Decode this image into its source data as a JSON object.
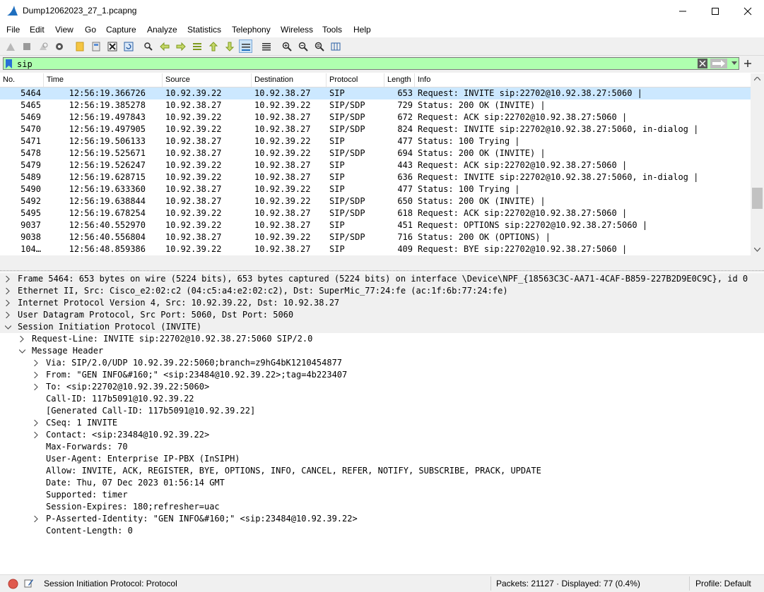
{
  "window": {
    "title": "Dump12062023_27_1.pcapng"
  },
  "menu": [
    "File",
    "Edit",
    "View",
    "Go",
    "Capture",
    "Analyze",
    "Statistics",
    "Telephony",
    "Wireless",
    "Tools",
    "Help"
  ],
  "filter": {
    "value": "sip"
  },
  "columns": [
    "No.",
    "Time",
    "Source",
    "Destination",
    "Protocol",
    "Length",
    "Info"
  ],
  "packets": [
    {
      "no": "5464",
      "time": "12:56:19.366726",
      "src": "10.92.39.22",
      "dst": "10.92.38.27",
      "proto": "SIP",
      "len": "653",
      "info": "Request: INVITE sip:22702@10.92.38.27:5060 |",
      "selected": true
    },
    {
      "no": "5465",
      "time": "12:56:19.385278",
      "src": "10.92.38.27",
      "dst": "10.92.39.22",
      "proto": "SIP/SDP",
      "len": "729",
      "info": "Status: 200 OK (INVITE) |"
    },
    {
      "no": "5469",
      "time": "12:56:19.497843",
      "src": "10.92.39.22",
      "dst": "10.92.38.27",
      "proto": "SIP/SDP",
      "len": "672",
      "info": "Request: ACK sip:22702@10.92.38.27:5060 |"
    },
    {
      "no": "5470",
      "time": "12:56:19.497905",
      "src": "10.92.39.22",
      "dst": "10.92.38.27",
      "proto": "SIP/SDP",
      "len": "824",
      "info": "Request: INVITE sip:22702@10.92.38.27:5060, in-dialog |"
    },
    {
      "no": "5471",
      "time": "12:56:19.506133",
      "src": "10.92.38.27",
      "dst": "10.92.39.22",
      "proto": "SIP",
      "len": "477",
      "info": "Status: 100 Trying |"
    },
    {
      "no": "5478",
      "time": "12:56:19.525671",
      "src": "10.92.38.27",
      "dst": "10.92.39.22",
      "proto": "SIP/SDP",
      "len": "694",
      "info": "Status: 200 OK (INVITE) |"
    },
    {
      "no": "5479",
      "time": "12:56:19.526247",
      "src": "10.92.39.22",
      "dst": "10.92.38.27",
      "proto": "SIP",
      "len": "443",
      "info": "Request: ACK sip:22702@10.92.38.27:5060 |"
    },
    {
      "no": "5489",
      "time": "12:56:19.628715",
      "src": "10.92.39.22",
      "dst": "10.92.38.27",
      "proto": "SIP",
      "len": "636",
      "info": "Request: INVITE sip:22702@10.92.38.27:5060, in-dialog |"
    },
    {
      "no": "5490",
      "time": "12:56:19.633360",
      "src": "10.92.38.27",
      "dst": "10.92.39.22",
      "proto": "SIP",
      "len": "477",
      "info": "Status: 100 Trying |"
    },
    {
      "no": "5492",
      "time": "12:56:19.638844",
      "src": "10.92.38.27",
      "dst": "10.92.39.22",
      "proto": "SIP/SDP",
      "len": "650",
      "info": "Status: 200 OK (INVITE) |"
    },
    {
      "no": "5495",
      "time": "12:56:19.678254",
      "src": "10.92.39.22",
      "dst": "10.92.38.27",
      "proto": "SIP/SDP",
      "len": "618",
      "info": "Request: ACK sip:22702@10.92.38.27:5060 |"
    },
    {
      "no": "9037",
      "time": "12:56:40.552970",
      "src": "10.92.39.22",
      "dst": "10.92.38.27",
      "proto": "SIP",
      "len": "451",
      "info": "Request: OPTIONS sip:22702@10.92.38.27:5060 |"
    },
    {
      "no": "9038",
      "time": "12:56:40.556804",
      "src": "10.92.38.27",
      "dst": "10.92.39.22",
      "proto": "SIP/SDP",
      "len": "716",
      "info": "Status: 200 OK (OPTIONS) |"
    },
    {
      "no": "104…",
      "time": "12:56:48.859386",
      "src": "10.92.39.22",
      "dst": "10.92.38.27",
      "proto": "SIP",
      "len": "409",
      "info": "Request: BYE sip:22702@10.92.38.27:5060 |"
    }
  ],
  "details": [
    {
      "indent": 0,
      "arrow": "right",
      "shade": true,
      "text": "Frame 5464: 653 bytes on wire (5224 bits), 653 bytes captured (5224 bits) on interface \\Device\\NPF_{18563C3C-AA71-4CAF-B859-227B2D9E0C9C}, id 0"
    },
    {
      "indent": 0,
      "arrow": "right",
      "shade": true,
      "text": "Ethernet II, Src: Cisco_e2:02:c2 (04:c5:a4:e2:02:c2), Dst: SuperMic_77:24:fe (ac:1f:6b:77:24:fe)"
    },
    {
      "indent": 0,
      "arrow": "right",
      "shade": true,
      "text": "Internet Protocol Version 4, Src: 10.92.39.22, Dst: 10.92.38.27"
    },
    {
      "indent": 0,
      "arrow": "right",
      "shade": true,
      "text": "User Datagram Protocol, Src Port: 5060, Dst Port: 5060"
    },
    {
      "indent": 0,
      "arrow": "down",
      "shade": true,
      "text": "Session Initiation Protocol (INVITE)"
    },
    {
      "indent": 1,
      "arrow": "right",
      "text": "Request-Line: INVITE sip:22702@10.92.38.27:5060 SIP/2.0"
    },
    {
      "indent": 1,
      "arrow": "down",
      "text": "Message Header"
    },
    {
      "indent": 2,
      "arrow": "right",
      "text": "Via: SIP/2.0/UDP 10.92.39.22:5060;branch=z9hG4bK1210454877"
    },
    {
      "indent": 2,
      "arrow": "right",
      "text": "From: \"GEN INFO&#160;\" <sip:23484@10.92.39.22>;tag=4b223407"
    },
    {
      "indent": 2,
      "arrow": "right",
      "text": "To: <sip:22702@10.92.39.22:5060>"
    },
    {
      "indent": 2,
      "arrow": "none",
      "text": "Call-ID: 117b5091@10.92.39.22"
    },
    {
      "indent": 2,
      "arrow": "none",
      "text": "[Generated Call-ID: 117b5091@10.92.39.22]"
    },
    {
      "indent": 2,
      "arrow": "right",
      "text": "CSeq: 1 INVITE"
    },
    {
      "indent": 2,
      "arrow": "right",
      "text": "Contact: <sip:23484@10.92.39.22>"
    },
    {
      "indent": 2,
      "arrow": "none",
      "text": "Max-Forwards: 70"
    },
    {
      "indent": 2,
      "arrow": "none",
      "text": "User-Agent: Enterprise IP-PBX (InSIPH)"
    },
    {
      "indent": 2,
      "arrow": "none",
      "text": "Allow: INVITE, ACK, REGISTER, BYE, OPTIONS, INFO, CANCEL, REFER, NOTIFY, SUBSCRIBE, PRACK, UPDATE"
    },
    {
      "indent": 2,
      "arrow": "none",
      "text": "Date: Thu, 07 Dec 2023 01:56:14 GMT"
    },
    {
      "indent": 2,
      "arrow": "none",
      "text": "Supported: timer"
    },
    {
      "indent": 2,
      "arrow": "none",
      "text": "Session-Expires: 180;refresher=uac"
    },
    {
      "indent": 2,
      "arrow": "right",
      "text": "P-Asserted-Identity: \"GEN INFO&#160;\" <sip:23484@10.92.39.22>"
    },
    {
      "indent": 2,
      "arrow": "none",
      "text": "Content-Length: 0"
    }
  ],
  "status": {
    "protocol": "Session Initiation Protocol: Protocol",
    "packets": "Packets: 21127 · Displayed: 77 (0.4%)",
    "profile": "Profile: Default"
  },
  "colors": {
    "selection": "#cce8ff",
    "filter_ok": "#afffaf",
    "accent": "#1f6fbf"
  }
}
